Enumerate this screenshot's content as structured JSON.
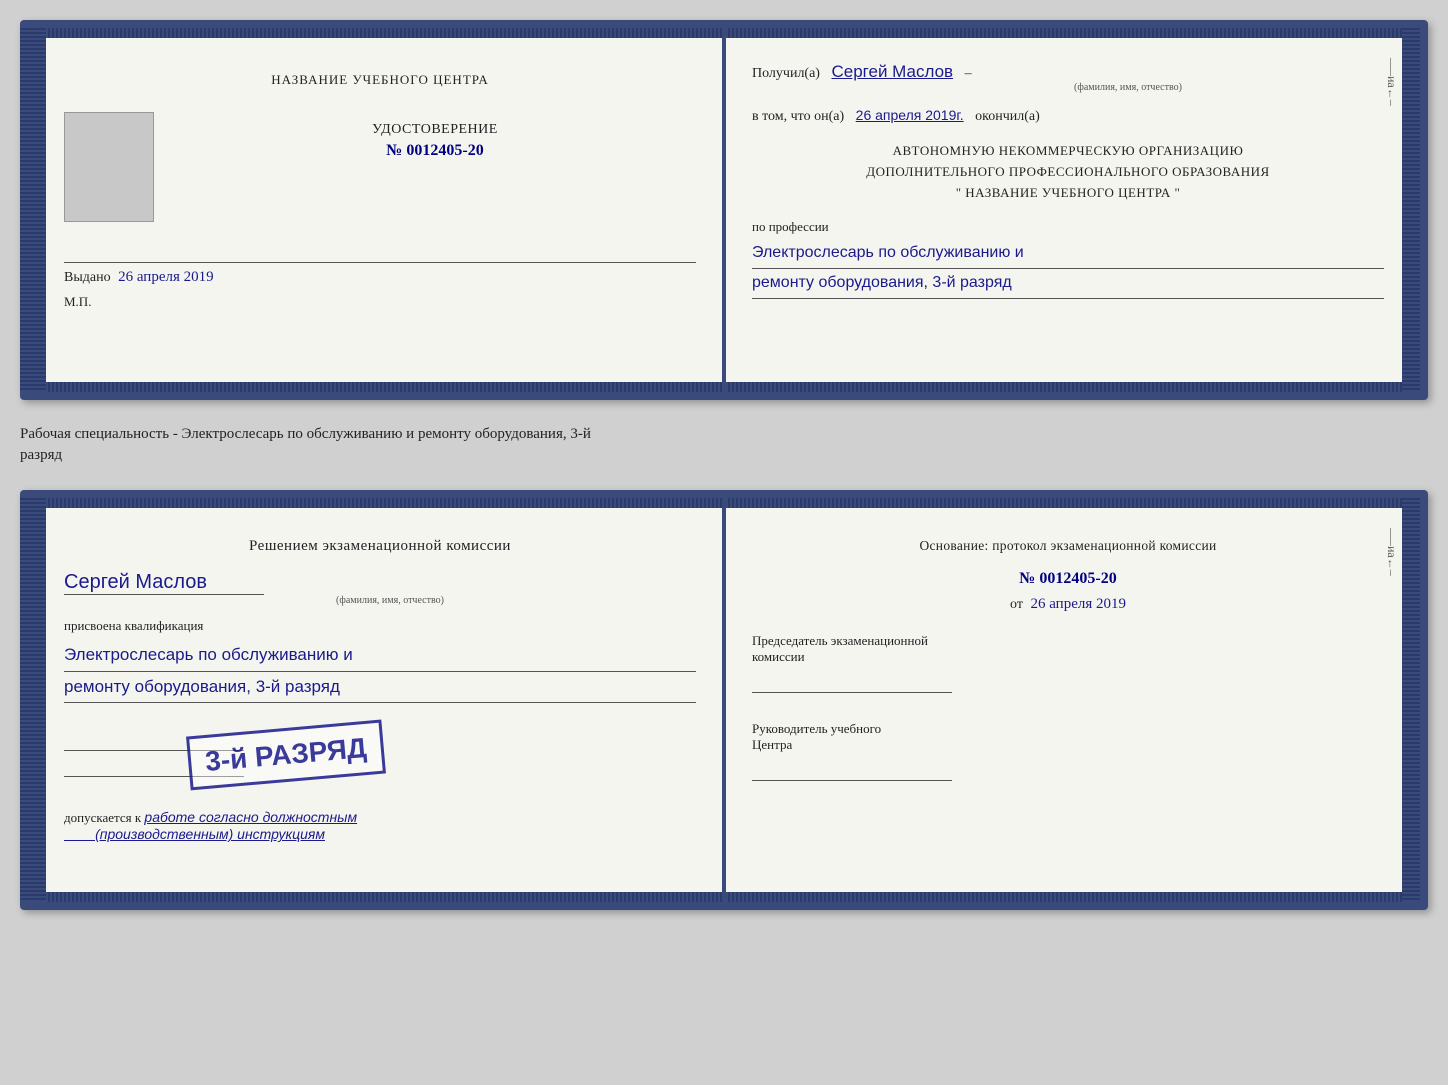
{
  "cert1": {
    "left": {
      "title": "НАЗВАНИЕ УЧЕБНОГО ЦЕНТРА",
      "photo_placeholder": "",
      "id_label": "УДОСТОВЕРЕНИЕ",
      "id_prefix": "№",
      "id_number": "0012405-20",
      "issued_label": "Выдано",
      "issued_date": "26 апреля 2019",
      "mp_label": "М.П."
    },
    "right": {
      "received_prefix": "Получил(а)",
      "recipient_name": "Сергей Маслов",
      "name_hint": "(фамилия, имя, отчество)",
      "date_prefix": "в том, что он(а)",
      "date_value": "26 апреля 2019г.",
      "date_suffix": "окончил(а)",
      "org_line1": "АВТОНОМНУЮ НЕКОММЕРЧЕСКУЮ ОРГАНИЗАЦИЮ",
      "org_line2": "ДОПОЛНИТЕЛЬНОГО ПРОФЕССИОНАЛЬНОГО ОБРАЗОВАНИЯ",
      "org_line3": "\"  НАЗВАНИЕ УЧЕБНОГО ЦЕНТРА  \"",
      "profession_prefix": "по профессии",
      "profession_line1": "Электрослесарь по обслуживанию и",
      "profession_line2": "ремонту оборудования, 3-й разряд"
    }
  },
  "specialty_text": "Рабочая специальность - Электрослесарь по обслуживанию и ремонту оборудования, 3-й\nразряд",
  "cert2": {
    "left": {
      "heading": "Решением экзаменационной  комиссии",
      "name": "Сергей Маслов",
      "name_hint": "(фамилия, имя, отчество)",
      "assigned_label": "присвоена квалификация",
      "qual_line1": "Электрослесарь по обслуживанию и",
      "qual_line2": "ремонту оборудования, 3-й разряд",
      "allowed_prefix": "допускается к",
      "allowed_text": "работе согласно должностным\n(производственным) инструкциям",
      "stamp_text": "3-й РАЗРЯД"
    },
    "right": {
      "basis_label": "Основание: протокол экзаменационной  комиссии",
      "doc_prefix": "№",
      "doc_number": "0012405-20",
      "date_prefix": "от",
      "date_value": "26 апреля 2019",
      "chairman_label": "Председатель экзаменационной\nкомиссии",
      "director_label": "Руководитель учебного\nЦентра"
    }
  },
  "right_deco": {
    "chars": [
      "–",
      "–",
      "–",
      "и",
      "а",
      "←",
      "–"
    ]
  }
}
